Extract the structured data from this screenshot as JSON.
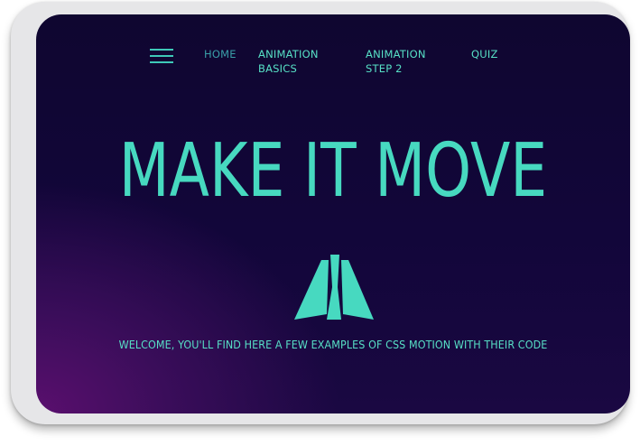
{
  "nav": {
    "menu_icon": "hamburger-menu-icon",
    "items": [
      {
        "label": "HOME"
      },
      {
        "line1": "ANIMATION",
        "line2": "BASICS"
      },
      {
        "line1": "ANIMATION",
        "line2": "STEP 2"
      },
      {
        "label": "QUIZ"
      }
    ]
  },
  "hero": {
    "title": "MAKE IT MOVE",
    "logo_icon": "tri-bar-logo-icon",
    "welcome": "WELCOME, YOU'LL FIND HERE A FEW EXAMPLES OF CSS MOTION WITH THEIR CODE"
  },
  "colors": {
    "accent": "#47d9c0",
    "home_link": "#3a9fa8",
    "background_top": "#0f0630",
    "background_glow": "#5a0f6e",
    "frame": "#e6e6e8"
  }
}
